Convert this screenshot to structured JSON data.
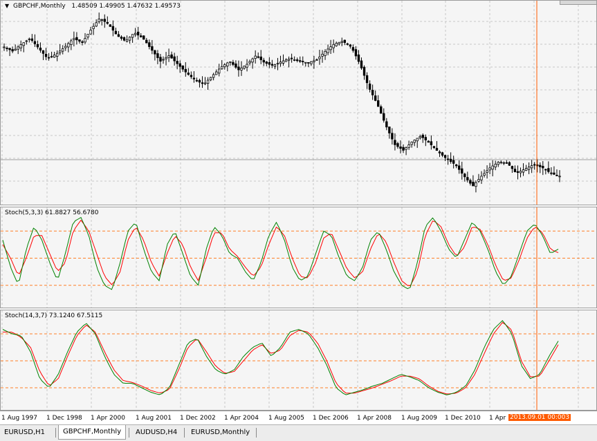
{
  "price_pane": {
    "symbol_label": "GBPCHF,Monthly",
    "ohlc_values": "1.48509 1.49905 1.47632 1.49573",
    "menu_icon": "triangle-down-icon"
  },
  "stoch1": {
    "label": "Stoch(5,3,3) 61.8827 56.6780"
  },
  "stoch2": {
    "label": "Stoch(14,3,7) 73.1240 67.5115"
  },
  "time_axis": {
    "ticks": [
      "1 Aug 1997",
      "1 Dec 1998",
      "1 Apr 2000",
      "1 Aug 2001",
      "1 Dec 2002",
      "1 Apr 2004",
      "1 Aug 2005",
      "1 Dec 2006",
      "1 Apr 2008",
      "1 Aug 2009",
      "1 Dec 2010",
      "1 Apr"
    ],
    "cursor_label": "2013.09.01 00:00",
    "cursor_suffix": "3"
  },
  "tabs": [
    {
      "label": "EURUSD,H1",
      "active": false
    },
    {
      "label": "GBPCHF,Monthly",
      "active": true
    },
    {
      "label": "AUDUSD,H4",
      "active": false
    },
    {
      "label": "EURUSD,Monthly",
      "active": false
    }
  ],
  "colors": {
    "pane_bg": "#f5f5f5",
    "grid": "#c8c8c8",
    "candle": "#000000",
    "stoch_main": "#008000",
    "stoch_signal": "#ff0000",
    "level_line": "#ff7f27",
    "cursor_line": "#ff5a00"
  },
  "chart_data": [
    {
      "type": "candlestick",
      "title": "GBPCHF,Monthly",
      "x_range": [
        "1997-08",
        "2014-01"
      ],
      "close_path": [
        2.5,
        2.47,
        2.52,
        2.56,
        2.49,
        2.42,
        2.45,
        2.5,
        2.56,
        2.53,
        2.62,
        2.7,
        2.66,
        2.58,
        2.54,
        2.6,
        2.56,
        2.48,
        2.4,
        2.44,
        2.38,
        2.32,
        2.27,
        2.24,
        2.3,
        2.36,
        2.4,
        2.34,
        2.38,
        2.44,
        2.39,
        2.37,
        2.4,
        2.42,
        2.4,
        2.39,
        2.41,
        2.47,
        2.52,
        2.54,
        2.5,
        2.38,
        2.22,
        2.1,
        1.95,
        1.82,
        1.78,
        1.84,
        1.88,
        1.83,
        1.77,
        1.72,
        1.68,
        1.6,
        1.53,
        1.6,
        1.66,
        1.7,
        1.69,
        1.62,
        1.65,
        1.68,
        1.66,
        1.62,
        1.6
      ],
      "final_ohlc": [
        1.48509,
        1.49905,
        1.47632,
        1.49573
      ]
    },
    {
      "type": "line",
      "title": "Stoch(5,3,3)",
      "ylim": [
        0,
        100
      ],
      "levels": [
        80,
        50,
        20
      ],
      "series": [
        {
          "name": "main",
          "last": 61.8827
        },
        {
          "name": "signal",
          "last": 56.678
        }
      ],
      "path_main": [
        70,
        40,
        20,
        60,
        85,
        70,
        45,
        25,
        55,
        90,
        95,
        75,
        40,
        20,
        15,
        45,
        80,
        90,
        60,
        35,
        25,
        65,
        80,
        55,
        30,
        20,
        60,
        85,
        75,
        55,
        50,
        35,
        25,
        45,
        75,
        90,
        70,
        40,
        25,
        30,
        55,
        80,
        75,
        50,
        30,
        25,
        40,
        70,
        80,
        60,
        35,
        20,
        15,
        45,
        85,
        95,
        80,
        60,
        50,
        70,
        90,
        80,
        60,
        35,
        20,
        30,
        55,
        80,
        88,
        75,
        55,
        60
      ],
      "path_signal": [
        65,
        50,
        30,
        50,
        75,
        75,
        55,
        35,
        45,
        80,
        92,
        80,
        55,
        30,
        20,
        35,
        70,
        85,
        70,
        45,
        30,
        55,
        75,
        65,
        40,
        25,
        50,
        78,
        78,
        60,
        52,
        40,
        30,
        40,
        65,
        85,
        75,
        50,
        30,
        28,
        45,
        72,
        78,
        58,
        38,
        28,
        35,
        60,
        78,
        68,
        45,
        25,
        18,
        35,
        75,
        92,
        85,
        65,
        52,
        62,
        85,
        82,
        65,
        42,
        25,
        28,
        48,
        72,
        85,
        78,
        60,
        56
      ]
    },
    {
      "type": "line",
      "title": "Stoch(14,3,7)",
      "ylim": [
        0,
        100
      ],
      "levels": [
        80,
        50,
        20
      ],
      "series": [
        {
          "name": "main",
          "last": 73.124
        },
        {
          "name": "signal",
          "last": 67.5115
        }
      ],
      "path_main": [
        85,
        80,
        78,
        60,
        30,
        20,
        35,
        60,
        82,
        92,
        80,
        55,
        35,
        25,
        25,
        20,
        15,
        12,
        20,
        45,
        70,
        75,
        55,
        40,
        35,
        40,
        55,
        65,
        70,
        55,
        65,
        82,
        85,
        80,
        65,
        45,
        20,
        12,
        15,
        18,
        22,
        25,
        30,
        35,
        32,
        28,
        20,
        15,
        12,
        15,
        22,
        40,
        65,
        85,
        95,
        80,
        45,
        30,
        35,
        55,
        72
      ],
      "path_signal": [
        82,
        82,
        76,
        65,
        38,
        22,
        30,
        55,
        78,
        90,
        82,
        60,
        40,
        28,
        26,
        22,
        17,
        14,
        18,
        40,
        65,
        75,
        60,
        44,
        36,
        38,
        50,
        62,
        68,
        58,
        62,
        78,
        84,
        82,
        70,
        50,
        25,
        14,
        14,
        17,
        20,
        24,
        28,
        33,
        33,
        30,
        22,
        16,
        13,
        14,
        20,
        35,
        58,
        80,
        93,
        84,
        50,
        32,
        33,
        50,
        68
      ]
    }
  ]
}
